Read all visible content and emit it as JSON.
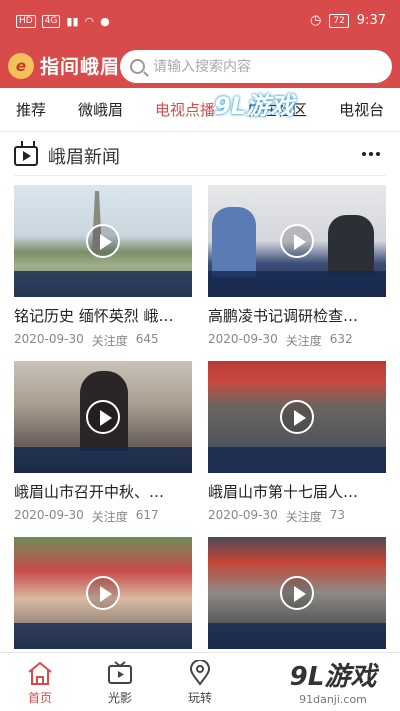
{
  "status": {
    "left_chips": [
      "HD",
      "4G"
    ],
    "battery": "72",
    "time": "9:37"
  },
  "header": {
    "logo_mark": "e",
    "app_title": "指间峨眉",
    "search_placeholder": "请输入搜索内容"
  },
  "tabs": [
    {
      "label": "推荐",
      "active": false
    },
    {
      "label": "微峨眉",
      "active": false
    },
    {
      "label": "电视点播",
      "active": true
    },
    {
      "label": "自在社区",
      "active": false
    },
    {
      "label": "电视台",
      "active": false
    }
  ],
  "section": {
    "title": "峨眉新闻"
  },
  "cards": [
    {
      "title": "铭记历史 缅怀英烈 峨…",
      "date": "2020-09-30",
      "follow_label": "关注度",
      "follow_count": "645"
    },
    {
      "title": "高鹏凌书记调研检查…",
      "date": "2020-09-30",
      "follow_label": "关注度",
      "follow_count": "632"
    },
    {
      "title": "峨眉山市召开中秋、…",
      "date": "2020-09-30",
      "follow_label": "关注度",
      "follow_count": "617"
    },
    {
      "title": "峨眉山市第十七届人…",
      "date": "2020-09-30",
      "follow_label": "关注度",
      "follow_count": "73"
    },
    {
      "title": "",
      "date": "",
      "follow_label": "",
      "follow_count": ""
    },
    {
      "title": "",
      "date": "",
      "follow_label": "",
      "follow_count": ""
    }
  ],
  "bottom_nav": [
    {
      "label": "首页",
      "icon": "home-icon",
      "active": true
    },
    {
      "label": "光影",
      "icon": "tv-icon",
      "active": false
    },
    {
      "label": "玩转",
      "icon": "location-icon",
      "active": false
    }
  ],
  "watermark": {
    "big": "9L游戏",
    "small": "91danji.com",
    "top": "9L游戏"
  },
  "colors": {
    "brand": "#d94b4b",
    "active_tab": "#d94b4b"
  }
}
